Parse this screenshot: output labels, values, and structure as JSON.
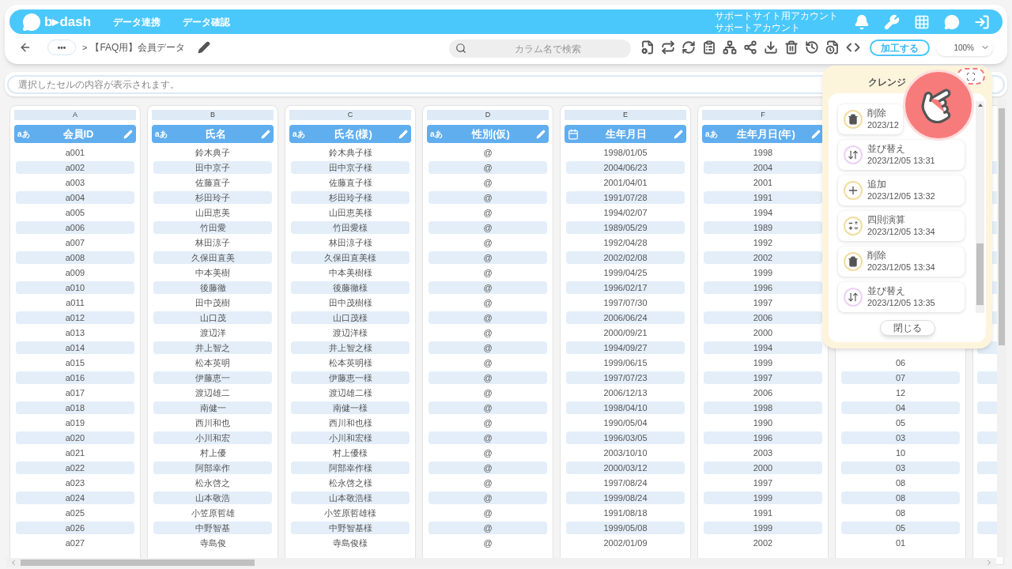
{
  "header": {
    "logo": "b▸dash",
    "nav": [
      "データ連携",
      "データ確認"
    ],
    "account": [
      "サポートサイト用アカウント",
      "サポートアカウント"
    ]
  },
  "toolbar": {
    "more": "•••",
    "separator": ">",
    "title": "【FAQ用】会員データ",
    "search": {
      "placeholder": "カラム名で検索"
    },
    "process_button": "加工する",
    "zoom": "100%"
  },
  "cell_viewer": {
    "placeholder": "選択したセルの内容が表示されます。"
  },
  "columns": [
    {
      "letter": "A",
      "name": "会員ID",
      "kind": "text",
      "type_label": "aあ"
    },
    {
      "letter": "B",
      "name": "氏名",
      "kind": "text",
      "type_label": "aあ"
    },
    {
      "letter": "C",
      "name": "氏名(様)",
      "kind": "text",
      "type_label": "aあ"
    },
    {
      "letter": "D",
      "name": "性別(仮)",
      "kind": "text",
      "type_label": "aあ"
    },
    {
      "letter": "E",
      "name": "生年月日",
      "kind": "date"
    },
    {
      "letter": "F",
      "name": "生年月日(年)",
      "kind": "text",
      "type_label": "aあ"
    }
  ],
  "rows": [
    {
      "cells": [
        "a001",
        "鈴木典子",
        "鈴木典子様",
        "@",
        "1998/01/05",
        "1998"
      ]
    },
    {
      "cells": [
        "a002",
        "田中京子",
        "田中京子様",
        "@",
        "2004/06/23",
        "2004"
      ]
    },
    {
      "cells": [
        "a003",
        "佐藤直子",
        "佐藤直子様",
        "@",
        "2001/04/01",
        "2001"
      ]
    },
    {
      "cells": [
        "a004",
        "杉田玲子",
        "杉田玲子様",
        "@",
        "1991/07/28",
        "1991"
      ]
    },
    {
      "cells": [
        "a005",
        "山田恵美",
        "山田恵美様",
        "@",
        "1994/02/07",
        "1994"
      ]
    },
    {
      "cells": [
        "a006",
        "竹田愛",
        "竹田愛様",
        "@",
        "1989/05/29",
        "1989"
      ]
    },
    {
      "cells": [
        "a007",
        "林田涼子",
        "林田涼子様",
        "@",
        "1992/04/28",
        "1992"
      ]
    },
    {
      "cells": [
        "a008",
        "久保田直美",
        "久保田直美様",
        "@",
        "2002/02/08",
        "2002"
      ]
    },
    {
      "cells": [
        "a009",
        "中本美樹",
        "中本美樹様",
        "@",
        "1999/04/25",
        "1999"
      ]
    },
    {
      "cells": [
        "a010",
        "後藤徹",
        "後藤徹様",
        "@",
        "1996/02/17",
        "1996"
      ]
    },
    {
      "cells": [
        "a011",
        "田中茂樹",
        "田中茂樹様",
        "@",
        "1997/07/30",
        "1997"
      ]
    },
    {
      "cells": [
        "a012",
        "山口茂",
        "山口茂様",
        "@",
        "2006/06/24",
        "2006"
      ]
    },
    {
      "cells": [
        "a013",
        "渡辺洋",
        "渡辺洋様",
        "@",
        "2000/09/21",
        "2000"
      ]
    },
    {
      "cells": [
        "a014",
        "井上智之",
        "井上智之様",
        "@",
        "1994/09/27",
        "1994"
      ]
    },
    {
      "cells": [
        "a015",
        "松本英明",
        "松本英明様",
        "@",
        "1999/06/15",
        "1999"
      ],
      "column_7": "06"
    },
    {
      "cells": [
        "a016",
        "伊藤恵一",
        "伊藤恵一様",
        "@",
        "1997/07/23",
        "1997"
      ],
      "column_7": "07"
    },
    {
      "cells": [
        "a017",
        "渡辺雄二",
        "渡辺雄二様",
        "@",
        "2006/12/13",
        "2006"
      ],
      "column_7": "12"
    },
    {
      "cells": [
        "a018",
        "南健一",
        "南健一様",
        "@",
        "1998/04/10",
        "1998"
      ],
      "column_7": "04"
    },
    {
      "cells": [
        "a019",
        "西川和也",
        "西川和也様",
        "@",
        "1990/05/04",
        "1990"
      ],
      "column_7": "05"
    },
    {
      "cells": [
        "a020",
        "小川和宏",
        "小川和宏様",
        "@",
        "1996/03/05",
        "1996"
      ],
      "column_7": "03"
    },
    {
      "cells": [
        "a021",
        "村上優",
        "村上優様",
        "@",
        "2003/10/10",
        "2003"
      ],
      "column_7": "10"
    },
    {
      "cells": [
        "a022",
        "阿部幸作",
        "阿部幸作様",
        "@",
        "2000/03/12",
        "2000"
      ],
      "column_7": "03"
    },
    {
      "cells": [
        "a023",
        "松永啓之",
        "松永啓之様",
        "@",
        "1997/08/24",
        "1997"
      ],
      "column_7": "08"
    },
    {
      "cells": [
        "a024",
        "山本敬浩",
        "山本敬浩様",
        "@",
        "1999/08/24",
        "1999"
      ],
      "column_7": "08"
    },
    {
      "cells": [
        "a025",
        "小笠原哲雄",
        "小笠原哲雄様",
        "@",
        "1991/08/18",
        "1991"
      ],
      "column_7": "08"
    },
    {
      "cells": [
        "a026",
        "中野智基",
        "中野智基様",
        "@",
        "1999/05/08",
        "1999"
      ],
      "column_7": "05"
    },
    {
      "cells": [
        "a027",
        "寺島俊",
        "寺島俊様",
        "@",
        "2002/01/09",
        "2002"
      ],
      "column_7": "01"
    }
  ],
  "history_panel": {
    "title": "クレンジ",
    "items": [
      {
        "kind": "delete",
        "label": "削除",
        "time": "2023/12"
      },
      {
        "kind": "sort",
        "label": "並び替え",
        "time": "2023/12/05 13:31"
      },
      {
        "kind": "add",
        "label": "追加",
        "time": "2023/12/05 13:32"
      },
      {
        "kind": "arithmetic",
        "label": "四則演算",
        "time": "2023/12/05 13:34"
      },
      {
        "kind": "delete",
        "label": "削除",
        "time": "2023/12/05 13:34"
      },
      {
        "kind": "sort",
        "label": "並び替え",
        "time": "2023/12/05 13:35"
      }
    ],
    "close_button": "閉じる"
  }
}
